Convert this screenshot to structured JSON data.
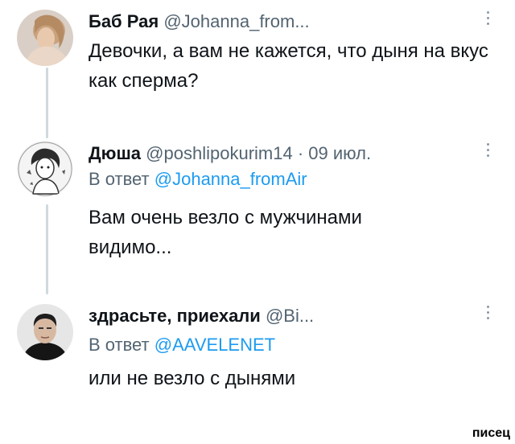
{
  "tweets": [
    {
      "name": "Баб Рая",
      "handle": "@Johanna_from...",
      "text": "Девочки, а вам не кажется, что дыня на вкус как сперма?"
    },
    {
      "name": "Дюша",
      "handle": "@poshlipokurim14 · 09 июл.",
      "reply_prefix": "В ответ",
      "reply_mention": "@Johanna_fromAir",
      "text": "Вам очень везло с мужчинами видимо..."
    },
    {
      "name": "здрасьте, приехали",
      "handle": "@Bi...",
      "reply_prefix": "В ответ",
      "reply_mention": "@AAVELENET",
      "text": "или не везло с дынями"
    }
  ],
  "watermark": "писец",
  "colors": {
    "mention": "#1d9bf0",
    "secondary_text": "#536471",
    "thread_line": "#cfd9de"
  }
}
